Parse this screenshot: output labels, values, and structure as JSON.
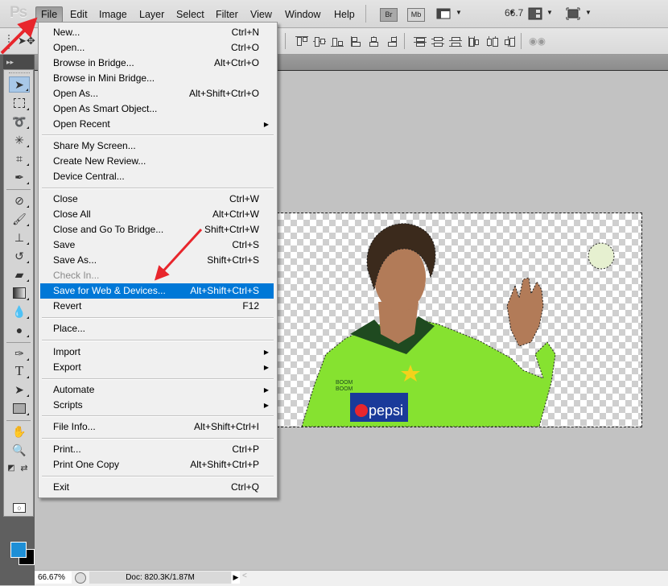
{
  "app": {
    "logo": "Ps"
  },
  "menubar": {
    "items": [
      "File",
      "Edit",
      "Image",
      "Layer",
      "Select",
      "Filter",
      "View",
      "Window",
      "Help"
    ],
    "active": "File",
    "app_buttons": {
      "bridge": "Br",
      "mini_bridge": "Mb"
    },
    "zoom_value": "66.7"
  },
  "tools_panel": {
    "collapse_glyph": "▸▸"
  },
  "file_menu": {
    "items": [
      {
        "label": "New...",
        "shortcut": "Ctrl+N"
      },
      {
        "label": "Open...",
        "shortcut": "Ctrl+O"
      },
      {
        "label": "Browse in Bridge...",
        "shortcut": "Alt+Ctrl+O"
      },
      {
        "label": "Browse in Mini Bridge...",
        "shortcut": ""
      },
      {
        "label": "Open As...",
        "shortcut": "Alt+Shift+Ctrl+O"
      },
      {
        "label": "Open As Smart Object...",
        "shortcut": ""
      },
      {
        "label": "Open Recent",
        "shortcut": "",
        "submenu": true
      },
      {
        "label": "Share My Screen...",
        "shortcut": ""
      },
      {
        "label": "Create New Review...",
        "shortcut": ""
      },
      {
        "label": "Device Central...",
        "shortcut": ""
      },
      {
        "label": "Close",
        "shortcut": "Ctrl+W"
      },
      {
        "label": "Close All",
        "shortcut": "Alt+Ctrl+W"
      },
      {
        "label": "Close and Go To Bridge...",
        "shortcut": "Shift+Ctrl+W"
      },
      {
        "label": "Save",
        "shortcut": "Ctrl+S"
      },
      {
        "label": "Save As...",
        "shortcut": "Shift+Ctrl+S"
      },
      {
        "label": "Check In...",
        "shortcut": "",
        "disabled": true
      },
      {
        "label": "Save for Web & Devices...",
        "shortcut": "Alt+Shift+Ctrl+S",
        "highlighted": true
      },
      {
        "label": "Revert",
        "shortcut": "F12"
      },
      {
        "label": "Place...",
        "shortcut": ""
      },
      {
        "label": "Import",
        "shortcut": "",
        "submenu": true
      },
      {
        "label": "Export",
        "shortcut": "",
        "submenu": true
      },
      {
        "label": "Automate",
        "shortcut": "",
        "submenu": true
      },
      {
        "label": "Scripts",
        "shortcut": "",
        "submenu": true
      },
      {
        "label": "File Info...",
        "shortcut": "Alt+Shift+Ctrl+I"
      },
      {
        "label": "Print...",
        "shortcut": "Ctrl+P"
      },
      {
        "label": "Print One Copy",
        "shortcut": "Alt+Shift+Ctrl+P"
      },
      {
        "label": "Exit",
        "shortcut": "Ctrl+Q"
      }
    ],
    "submenu_glyph": "▶"
  },
  "canvas": {
    "image_subject": "Cricket player in green Pakistan jersey with cutout background",
    "jersey_text": "pepsi",
    "jersey_sponsor_small": "BOOM BOOM"
  },
  "statusbar": {
    "zoom": "66.67%",
    "doc_info": "Doc: 820.3K/1.87M",
    "arrow_glyph": "▶",
    "scroll_glyph": "<"
  },
  "colors": {
    "foreground": "#1e8fd6",
    "background": "#000000",
    "menu_highlight": "#0078d7",
    "annotation_arrow": "#e8262c"
  }
}
